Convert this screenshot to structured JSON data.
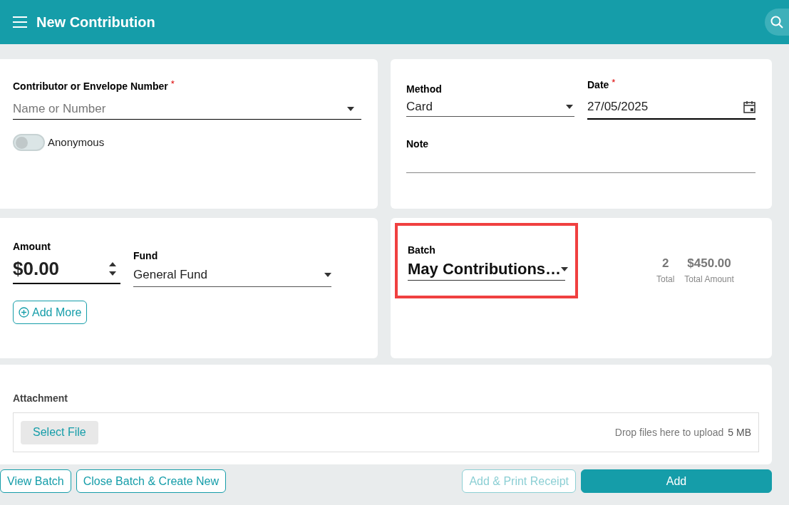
{
  "header": {
    "title": "New Contribution"
  },
  "contributor": {
    "label": "Contributor or Envelope Number",
    "required_mark": "*",
    "placeholder": "Name or Number"
  },
  "anonymous": {
    "label": "Anonymous",
    "on": false
  },
  "method": {
    "label": "Method",
    "value": "Card"
  },
  "date": {
    "label": "Date",
    "required_mark": "*",
    "value": "27/05/2025"
  },
  "note": {
    "label": "Note"
  },
  "amount": {
    "label": "Amount",
    "value": "$0.00"
  },
  "fund": {
    "label": "Fund",
    "value": "General Fund"
  },
  "add_more": "Add More",
  "batch": {
    "label": "Batch",
    "value": "May Contributions…",
    "highlighted": true
  },
  "stats": [
    {
      "value": "2",
      "label": "Total"
    },
    {
      "value": "$450.00",
      "label": "Total Amount"
    }
  ],
  "attachment": {
    "label": "Attachment",
    "button": "Select File",
    "hint": "Drop files here to upload",
    "limit": "5 MB"
  },
  "actions": [
    {
      "label": "View Batch",
      "kind": "outline",
      "disabled": false
    },
    {
      "label": "Close Batch & Create New",
      "kind": "outline",
      "disabled": false
    },
    {
      "label": "Add & Print Receipt",
      "kind": "outline",
      "disabled": true
    },
    {
      "label": "Add",
      "kind": "primary",
      "disabled": false
    }
  ]
}
